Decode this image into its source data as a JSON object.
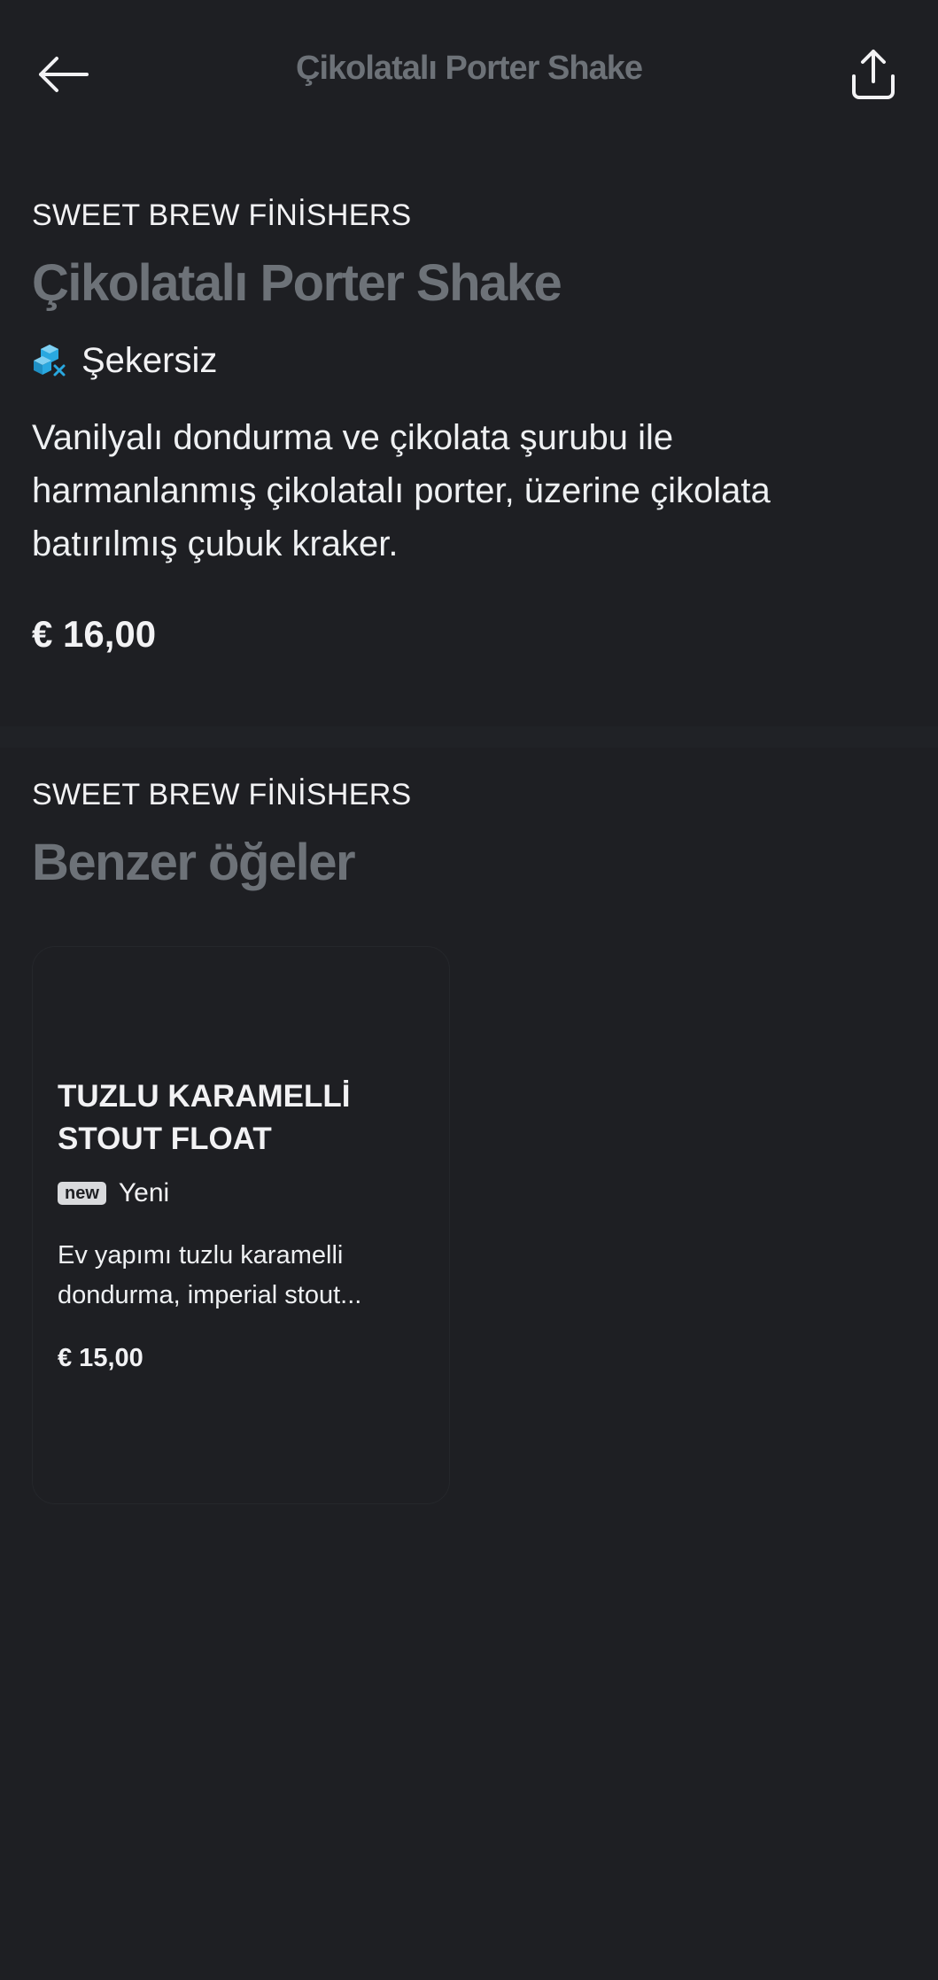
{
  "header": {
    "title": "Çikolatalı Porter Shake",
    "back_icon": "arrow-left-icon",
    "share_icon": "share-icon"
  },
  "item": {
    "category": "SWEET BREW FİNİSHERS",
    "title": "Çikolatalı Porter Shake",
    "tag_icon": "sugar-free-icon",
    "tag": "Şekersiz",
    "description": "Vanilyalı dondurma ve çikolata şurubu ile harmanlanmış çikolatalı porter, üzerine çikolata batırılmış çubuk kraker.",
    "price": "€ 16,00"
  },
  "similar": {
    "category": "SWEET BREW FİNİSHERS",
    "title": "Benzer öğeler",
    "items": [
      {
        "title": "TUZLU KARAMELLİ STOUT FLOAT",
        "badge": "new",
        "badge_label": "Yeni",
        "description": "Ev yapımı tuzlu karamelli dondurma, imperial stout...",
        "price": "€ 15,00"
      }
    ]
  },
  "colors": {
    "background": "#1e1f23",
    "muted_title": "#6d7278",
    "text": "#f2f2f4",
    "sugar_icon": "#29a8e0"
  }
}
